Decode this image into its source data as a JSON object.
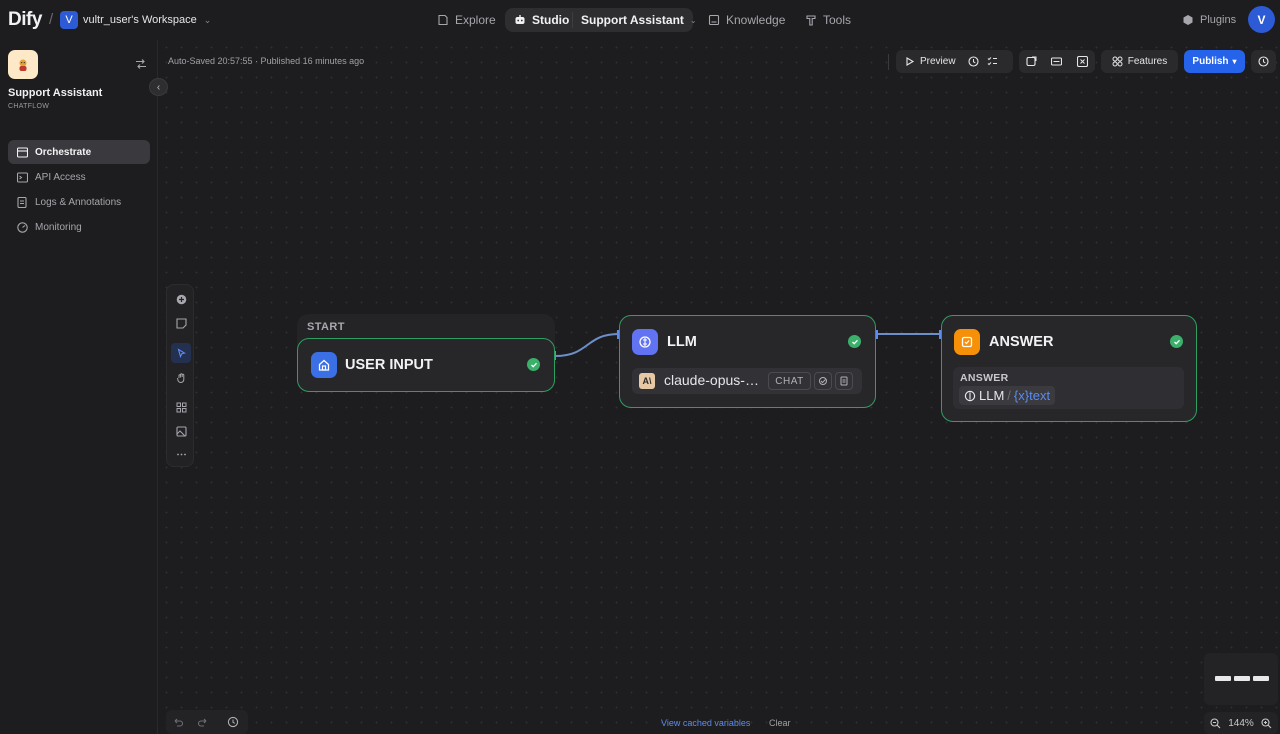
{
  "header": {
    "logo": "Dify",
    "separator": "/",
    "workspace": {
      "badge": "V",
      "name": "vultr_user's Workspace"
    },
    "nav": {
      "explore": "Explore",
      "studio": "Studio",
      "app": "Support Assistant",
      "knowledge": "Knowledge",
      "tools": "Tools"
    },
    "plugins": "Plugins",
    "avatar": "V"
  },
  "sidebar": {
    "app_name": "Support Assistant",
    "app_type": "CHATFLOW",
    "menu": [
      {
        "label": "Orchestrate",
        "active": true
      },
      {
        "label": "API Access"
      },
      {
        "label": "Logs & Annotations"
      },
      {
        "label": "Monitoring"
      }
    ]
  },
  "canvas": {
    "status": "Auto-Saved 20:57:55 · Published 16 minutes ago",
    "toolbar": {
      "preview": "Preview",
      "features": "Features",
      "publish": "Publish"
    },
    "nodes": {
      "start": {
        "tab": "START",
        "title": "USER INPUT"
      },
      "llm": {
        "title": "LLM",
        "model": "claude-opus-…",
        "mode": "CHAT"
      },
      "answer": {
        "title": "ANSWER",
        "field_label": "ANSWER",
        "var_source": "LLM",
        "var_sep": "/",
        "var_name": "{x}text"
      }
    },
    "bottom": {
      "cached": "View cached variables",
      "clear": "Clear",
      "zoom": "144%"
    }
  },
  "colors": {
    "accent": "#2563eb",
    "success": "#3ab06b",
    "llm_icon": "#6172f3",
    "answer_icon": "#f79009",
    "start_icon": "#3b6fe6"
  }
}
